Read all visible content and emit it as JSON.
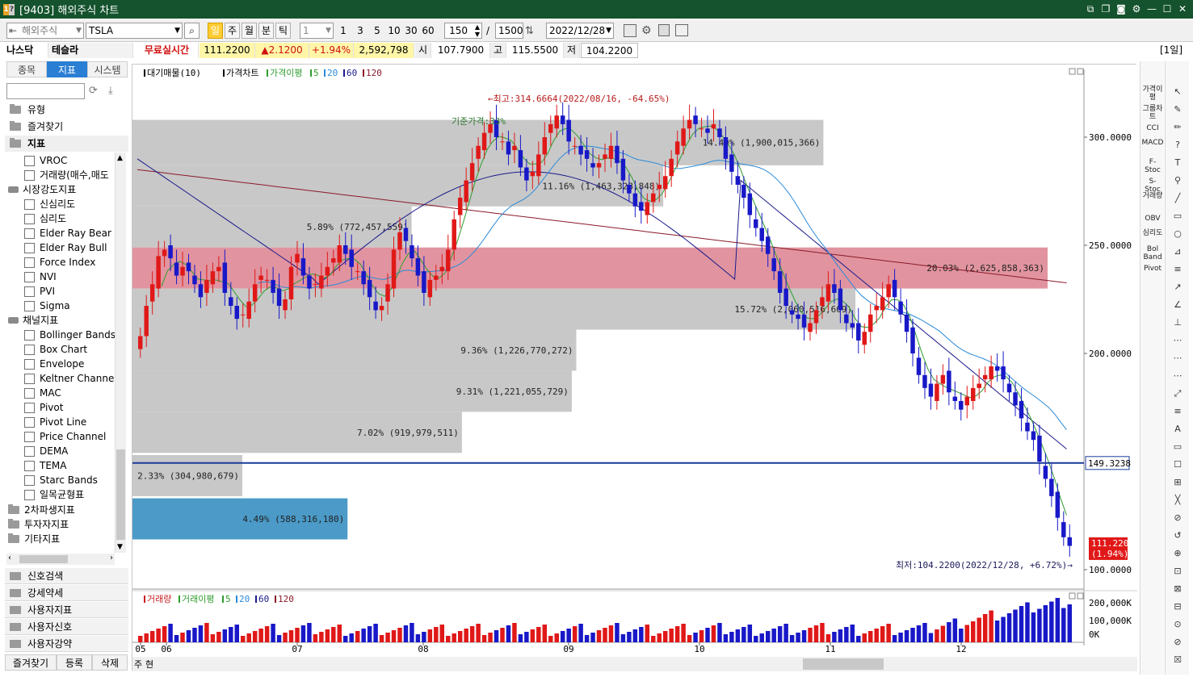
{
  "window": {
    "title": "[9403] 해외주식 차트",
    "icon_a": "1",
    "icon_b": "?"
  },
  "toolbar": {
    "market": "해외주식",
    "symbol": "TSLA",
    "periods": [
      "일",
      "주",
      "월",
      "분",
      "틱"
    ],
    "interval": "1",
    "nums": [
      "1",
      "3",
      "5",
      "10",
      "30",
      "60"
    ],
    "count": "150",
    "total": "1500",
    "date": "2022/12/28",
    "slash": "/"
  },
  "quote": {
    "exchange": "나스닥",
    "name": "테슬라",
    "realtime": "무료실시간",
    "price": "111.2200",
    "change": "▲2.1200",
    "pct": "+1.94%",
    "volume": "2,592,798",
    "open_label": "시",
    "open": "107.7900",
    "high_label": "고",
    "high": "115.5500",
    "low_label": "저",
    "low": "104.2200",
    "period": "[1일]"
  },
  "sidebar": {
    "tabs": [
      "종목",
      "지표",
      "시스템"
    ],
    "folders": [
      "유형",
      "즐겨찾기",
      "지표"
    ],
    "items1": [
      "VROC",
      "거래량(매수,매도"
    ],
    "cat1": "시장강도지표",
    "items2": [
      "신심리도",
      "심리도",
      "Elder Ray Bear",
      "Elder Ray Bull",
      "Force Index",
      "NVI",
      "PVI",
      "Sigma"
    ],
    "cat2": "채널지표",
    "items3": [
      "Bollinger Bands",
      "Box Chart",
      "Envelope",
      "Keltner Channels",
      "MAC",
      "Pivot",
      "Pivot Line",
      "Price Channel",
      "DEMA",
      "TEMA",
      "Starc Bands",
      "일목균형표"
    ],
    "cats3": [
      "2차파생지표",
      "투자자지표",
      "기타지표"
    ],
    "bottom": [
      "신호검색",
      "강세약세",
      "사용자지표",
      "사용자신호",
      "사용자강약"
    ],
    "buttons": [
      "즐겨찾기",
      "등록",
      "삭제"
    ]
  },
  "chart": {
    "legend": [
      {
        "t": "대기매물(10)",
        "c": "#000"
      },
      {
        "t": "가격차트",
        "c": "#000"
      },
      {
        "t": "가격이평",
        "c": "#2e9d2e"
      },
      {
        "t": "5",
        "c": "#2e9d2e"
      },
      {
        "t": "20",
        "c": "#2a8ad8"
      },
      {
        "t": "60",
        "c": "#1a1a8a"
      },
      {
        "t": "120",
        "c": "#8a1a2a"
      }
    ],
    "vol_legend": [
      {
        "t": "거래량",
        "c": "#c81e1e"
      },
      {
        "t": "거래이평",
        "c": "#2e9d2e"
      },
      {
        "t": "5",
        "c": "#2e9d2e"
      },
      {
        "t": "20",
        "c": "#2a8ad8"
      },
      {
        "t": "60",
        "c": "#1a1a8a"
      },
      {
        "t": "120",
        "c": "#8a1a2a"
      }
    ],
    "high_note": "←최고:314.6664(2022/08/16, -64.65%)",
    "low_note": "최저:104.2200(2022/12/28, +6.72%)→",
    "ref_note": "기준가격:33%",
    "hline_label": "149.3238",
    "price_label": "111.2200",
    "pct_label": "(1.94%)",
    "yaxis": [
      "300.0000",
      "250.0000",
      "200.0000",
      "100.0000"
    ],
    "vol_axis": [
      "200,000K",
      "100,000K",
      "0K"
    ],
    "months": [
      "05",
      "06",
      "07",
      "08",
      "09",
      "10",
      "11",
      "12"
    ],
    "zone_labels": [
      "14.49% (1,900,015,366)",
      "11.16% (1,463,328,848)",
      "5.89% (772,457,559)",
      "20.03% (2,625,858,363)",
      "15.72% (2,060,516,609)",
      "9.36% (1,226,770,272)",
      "9.31% (1,221,055,729)",
      "7.02% (919,979,511)",
      "2.33% (304,980,679)",
      "4.49% (588,316,180)"
    ],
    "bottom_btns": [
      "주",
      "현"
    ]
  },
  "right_tools": [
    "가격이평",
    "그룹차트",
    "CCI",
    "MACD",
    "F-Stoc",
    "S-Stoc",
    "거래량",
    "OBV",
    "심리도",
    "Bol Band",
    "Pivot"
  ],
  "chart_data": {
    "type": "candlestick",
    "title": "",
    "ylim": [
      100,
      320
    ],
    "high": {
      "value": 314.6664,
      "date": "2022/08/16"
    },
    "low": {
      "value": 104.22,
      "date": "2022/12/28"
    },
    "last": 111.22,
    "hline": 149.3238,
    "volume_profile": [
      {
        "pct": 14.49,
        "volume": 1900015366
      },
      {
        "pct": 11.16,
        "volume": 1463328848
      },
      {
        "pct": 5.89,
        "volume": 772457559
      },
      {
        "pct": 20.03,
        "volume": 2625858363
      },
      {
        "pct": 15.72,
        "volume": 2060516609
      },
      {
        "pct": 9.36,
        "volume": 1226770272
      },
      {
        "pct": 9.31,
        "volume": 1221055729
      },
      {
        "pct": 7.02,
        "volume": 919979511
      },
      {
        "pct": 2.33,
        "volume": 304980679
      },
      {
        "pct": 4.49,
        "volume": 588316180
      }
    ],
    "ma_periods": [
      5,
      20,
      60,
      120
    ]
  }
}
